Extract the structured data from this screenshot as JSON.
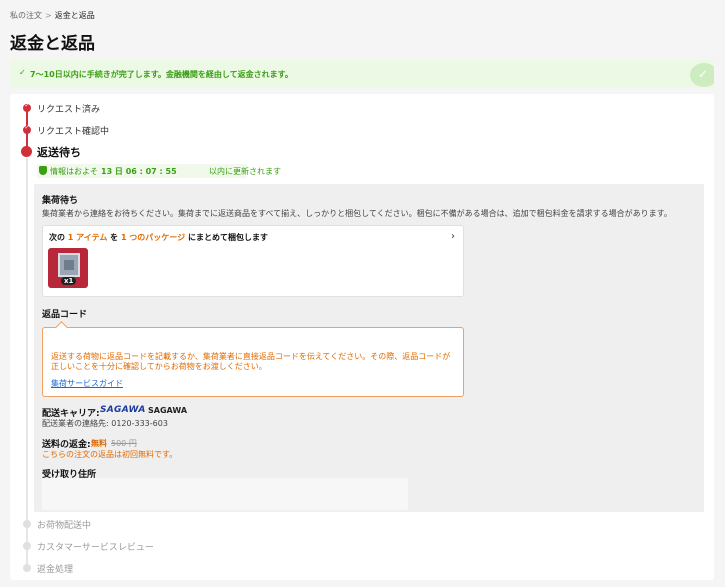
{
  "breadcrumb": {
    "parent": "私の注文",
    "separator": ">",
    "current": "返金と返品"
  },
  "page": {
    "title": "返金と返品"
  },
  "notice": {
    "text": "7〜10日以内に手続きが完了します。金融機関を経由して返金されます。"
  },
  "timeline": {
    "steps_done": [
      "リクエスト済み",
      "リクエスト確認中"
    ],
    "active": "返送待ち",
    "pending": [
      "お荷物配送中",
      "カスタマーサービスレビュー",
      "返金処理"
    ]
  },
  "update": {
    "prefix": "情報はおよそ",
    "time": "13 日 06 : 07 : 55",
    "suffix": "以内に更新されます"
  },
  "pickup": {
    "title": "集荷待ち",
    "description": "集荷業者から連絡をお待ちください。集荷までに返送商品をすべて揃え、しっかりと梱包してください。梱包に不備がある場合は、追加で梱包料金を請求する場合があります。"
  },
  "package": {
    "pre": "次の",
    "count": "1 アイテム",
    "mid": "を",
    "packages": "1 つのパッケージ",
    "post": "にまとめて梱包します",
    "item_qty": "x1"
  },
  "return_code": {
    "title": "返品コード",
    "message": "返送する荷物に返品コードを記載するか、集荷業者に直接返品コードを伝えてください。その際、返品コードが正しいことを十分に確認してからお荷物をお渡しください。",
    "guide_link": "集荷サービスガイド"
  },
  "carrier": {
    "label": "配送キャリア:",
    "logo": "SAGAWA",
    "name": "SAGAWA",
    "contact": "配送業者の連絡先: 0120-333-603"
  },
  "shipping_refund": {
    "label": "送料の返金:",
    "value": "無料",
    "original": "500 円",
    "note": "こちらの注文の返品は初回無料です。"
  },
  "address": {
    "title": "受け取り住所"
  },
  "colors": {
    "accent_red": "#d0303a",
    "success_green": "#3a9f14",
    "warning_orange": "#e06a00",
    "link_blue": "#1a6ad4"
  }
}
